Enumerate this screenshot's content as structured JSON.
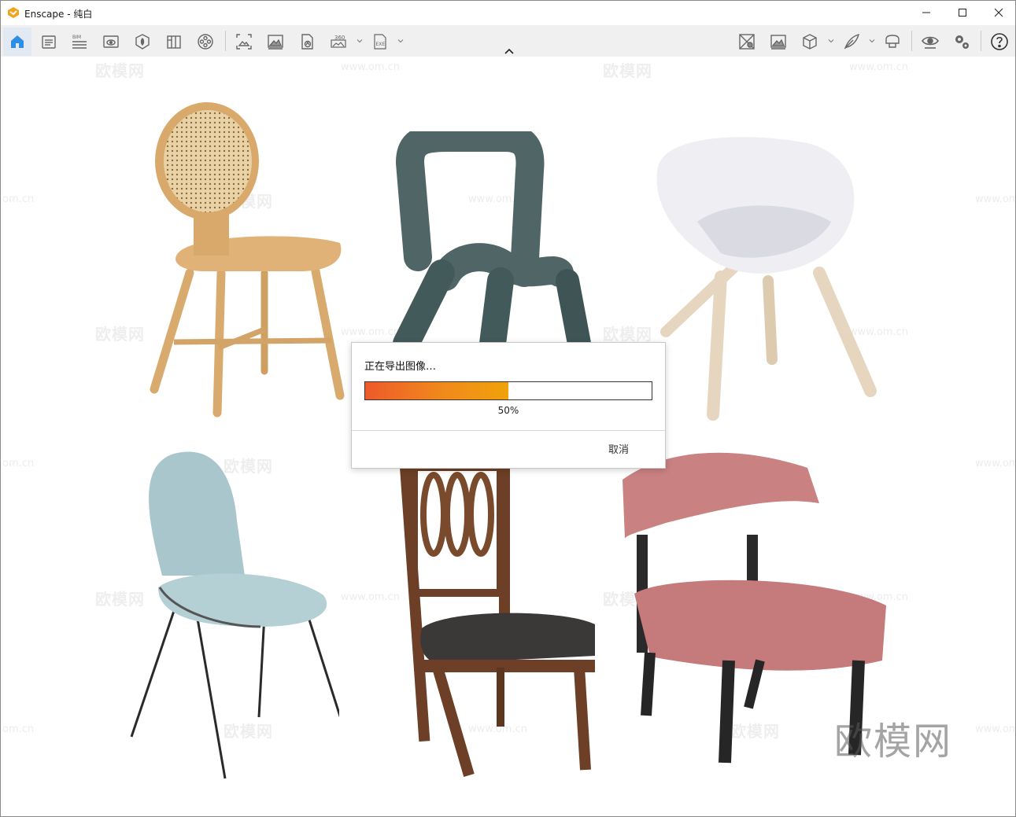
{
  "window": {
    "title": "Enscape - 纯白",
    "controls": {
      "minimize": "—",
      "maximize": "☐",
      "close": "✕"
    }
  },
  "toolbar": {
    "left_items": [
      {
        "name": "home",
        "icon": "home-icon",
        "active": true
      },
      {
        "name": "views",
        "icon": "views-icon"
      },
      {
        "name": "bim",
        "icon": "bim-icon"
      },
      {
        "name": "visual-settings",
        "icon": "visual-settings-icon"
      },
      {
        "name": "assets",
        "icon": "asset-library-icon"
      },
      {
        "name": "material-editor",
        "icon": "material-editor-icon"
      },
      {
        "name": "video-editor",
        "icon": "video-editor-icon"
      },
      {
        "name": "batch-render",
        "icon": "batch-render-icon"
      },
      {
        "name": "screenshot",
        "icon": "screenshot-icon"
      },
      {
        "name": "export-panorama",
        "icon": "export-panorama-icon"
      },
      {
        "name": "export-360",
        "icon": "export-360-icon",
        "has_dropdown": true
      },
      {
        "name": "export-exe",
        "icon": "export-exe-icon",
        "has_dropdown": true
      }
    ],
    "right_items": [
      {
        "name": "upload-gallery",
        "icon": "upload-gallery-icon"
      },
      {
        "name": "gallery",
        "icon": "gallery-icon"
      },
      {
        "name": "sync-views",
        "icon": "cube-icon",
        "has_dropdown": true
      },
      {
        "name": "collaboration",
        "icon": "feather-icon",
        "has_dropdown": true
      },
      {
        "name": "vr-headset",
        "icon": "vr-headset-icon"
      },
      {
        "name": "view-visibility",
        "icon": "eye-icon"
      },
      {
        "name": "settings",
        "icon": "gear-icon"
      },
      {
        "name": "help",
        "icon": "help-icon"
      }
    ],
    "bim_label": "BIM",
    "label_360": "360",
    "label_exe": "EXE"
  },
  "watermark": {
    "brand": "欧模网",
    "site": "www.om.cn",
    "site_short": "om.cn",
    "large_brand": "欧模网"
  },
  "dialog": {
    "title": "正在导出图像…",
    "progress_percent": 50,
    "progress_label": "50%",
    "cancel_label": "取消"
  },
  "colors": {
    "accent": "#2d8ee6",
    "progress_start": "#ee5a2a",
    "progress_end": "#f0a20a",
    "toolbar_bg": "#f0f0f0"
  }
}
